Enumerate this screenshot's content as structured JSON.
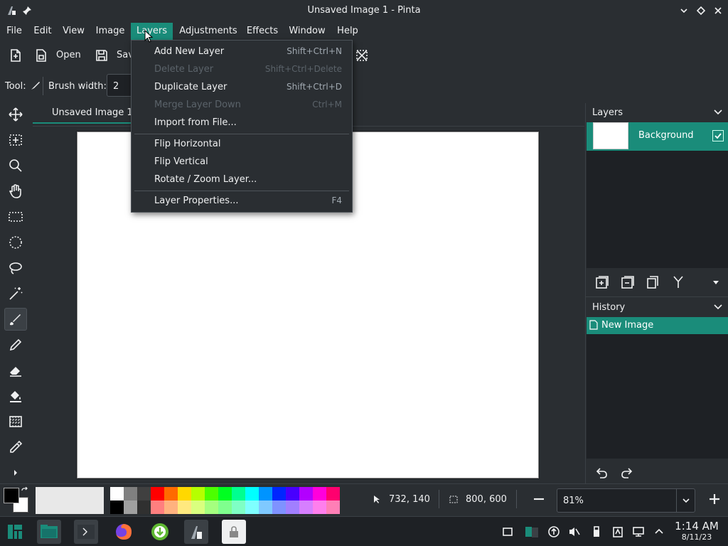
{
  "window": {
    "title": "Unsaved Image 1 - Pinta"
  },
  "menubar": {
    "items": [
      "File",
      "Edit",
      "View",
      "Image",
      "Layers",
      "Adjustments",
      "Effects",
      "Window",
      "Help"
    ],
    "active": "Layers"
  },
  "toolbar": {
    "open_label": "Open",
    "save_label": "Sav"
  },
  "tool_options": {
    "tool_label": "Tool:",
    "brush_width_label": "Brush width:",
    "brush_width_value": "2"
  },
  "document": {
    "tab_label": "Unsaved Image 1"
  },
  "layers_menu": {
    "items": [
      {
        "label": "Add New Layer",
        "shortcut": "Shift+Ctrl+N",
        "enabled": true
      },
      {
        "label": "Delete Layer",
        "shortcut": "Shift+Ctrl+Delete",
        "enabled": false
      },
      {
        "label": "Duplicate Layer",
        "shortcut": "Shift+Ctrl+D",
        "enabled": true
      },
      {
        "label": "Merge Layer Down",
        "shortcut": "Ctrl+M",
        "enabled": false
      },
      {
        "label": "Import from File...",
        "shortcut": "",
        "enabled": true
      },
      {
        "label": "Flip Horizontal",
        "shortcut": "",
        "enabled": true
      },
      {
        "label": "Flip Vertical",
        "shortcut": "",
        "enabled": true
      },
      {
        "label": "Rotate / Zoom Layer...",
        "shortcut": "",
        "enabled": true
      },
      {
        "label": "Layer Properties...",
        "shortcut": "F4",
        "enabled": true
      }
    ]
  },
  "layers_panel": {
    "title": "Layers",
    "layers": [
      {
        "name": "Background",
        "visible": true
      }
    ]
  },
  "history_panel": {
    "title": "History",
    "items": [
      "New Image"
    ]
  },
  "status": {
    "cursor_position": "732, 140",
    "selection_size": "800, 600",
    "zoom": "81%"
  },
  "palette": {
    "primary": "#000000",
    "secondary": "#ffffff",
    "top_row": [
      "#ffffff",
      "#808080",
      "#404040",
      "#ff0000",
      "#ff6a00",
      "#ffd800",
      "#b6ff00",
      "#4cff00",
      "#00ff21",
      "#00ff90",
      "#00ffff",
      "#0094ff",
      "#0026ff",
      "#4800ff",
      "#b200ff",
      "#ff00dc",
      "#ff006e"
    ],
    "bottom_row": [
      "#000000",
      "#a0a0a0",
      "#303030",
      "#ff7f7f",
      "#ffb27f",
      "#ffe97f",
      "#daff7f",
      "#a5ff7f",
      "#7fff8e",
      "#7fffc5",
      "#7fffff",
      "#7fc9ff",
      "#7f92ff",
      "#a17fff",
      "#d67fff",
      "#ff7fed",
      "#ff7fb6"
    ]
  },
  "taskbar": {
    "time": "1:14 AM",
    "date": "8/11/23"
  },
  "colors": {
    "accent": "#1a8c7a",
    "background": "#2a2e32"
  }
}
